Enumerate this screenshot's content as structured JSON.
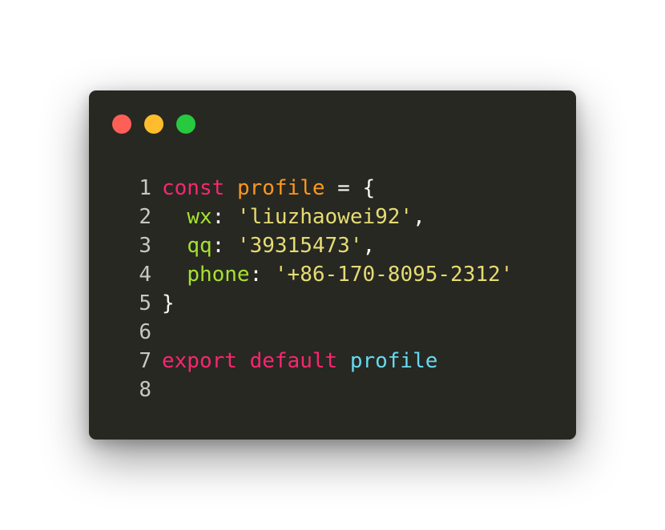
{
  "window": {
    "controls": [
      {
        "name": "close",
        "color": "#ff5f56"
      },
      {
        "name": "minimize",
        "color": "#ffbd2e"
      },
      {
        "name": "maximize",
        "color": "#27c93f"
      }
    ]
  },
  "theme": {
    "background": "#272822",
    "keyword": "#f92672",
    "variable": "#fd971f",
    "property": "#a6e22e",
    "string": "#e6db74",
    "identifier": "#66d9ef",
    "punctuation": "#f8f8f2",
    "line_number": "#c8c8c2"
  },
  "code": {
    "lines": [
      {
        "number": "1",
        "tokens": [
          {
            "text": "const",
            "type": "keyword"
          },
          {
            "text": " ",
            "type": "punctuation"
          },
          {
            "text": "profile",
            "type": "variable"
          },
          {
            "text": " = {",
            "type": "punctuation"
          }
        ]
      },
      {
        "number": "2",
        "tokens": [
          {
            "text": "  ",
            "type": "punctuation"
          },
          {
            "text": "wx",
            "type": "property"
          },
          {
            "text": ": ",
            "type": "punctuation"
          },
          {
            "text": "'liuzhaowei92'",
            "type": "string"
          },
          {
            "text": ",",
            "type": "punctuation"
          }
        ]
      },
      {
        "number": "3",
        "tokens": [
          {
            "text": "  ",
            "type": "punctuation"
          },
          {
            "text": "qq",
            "type": "property"
          },
          {
            "text": ": ",
            "type": "punctuation"
          },
          {
            "text": "'39315473'",
            "type": "string"
          },
          {
            "text": ",",
            "type": "punctuation"
          }
        ]
      },
      {
        "number": "4",
        "tokens": [
          {
            "text": "  ",
            "type": "punctuation"
          },
          {
            "text": "phone",
            "type": "property"
          },
          {
            "text": ": ",
            "type": "punctuation"
          },
          {
            "text": "'+86-170-8095-2312'",
            "type": "string"
          }
        ]
      },
      {
        "number": "5",
        "tokens": [
          {
            "text": "}",
            "type": "punctuation"
          }
        ]
      },
      {
        "number": "6",
        "tokens": []
      },
      {
        "number": "7",
        "tokens": [
          {
            "text": "export",
            "type": "keyword"
          },
          {
            "text": " ",
            "type": "punctuation"
          },
          {
            "text": "default",
            "type": "keyword"
          },
          {
            "text": " ",
            "type": "punctuation"
          },
          {
            "text": "profile",
            "type": "identifier"
          }
        ]
      },
      {
        "number": "8",
        "tokens": []
      }
    ]
  }
}
